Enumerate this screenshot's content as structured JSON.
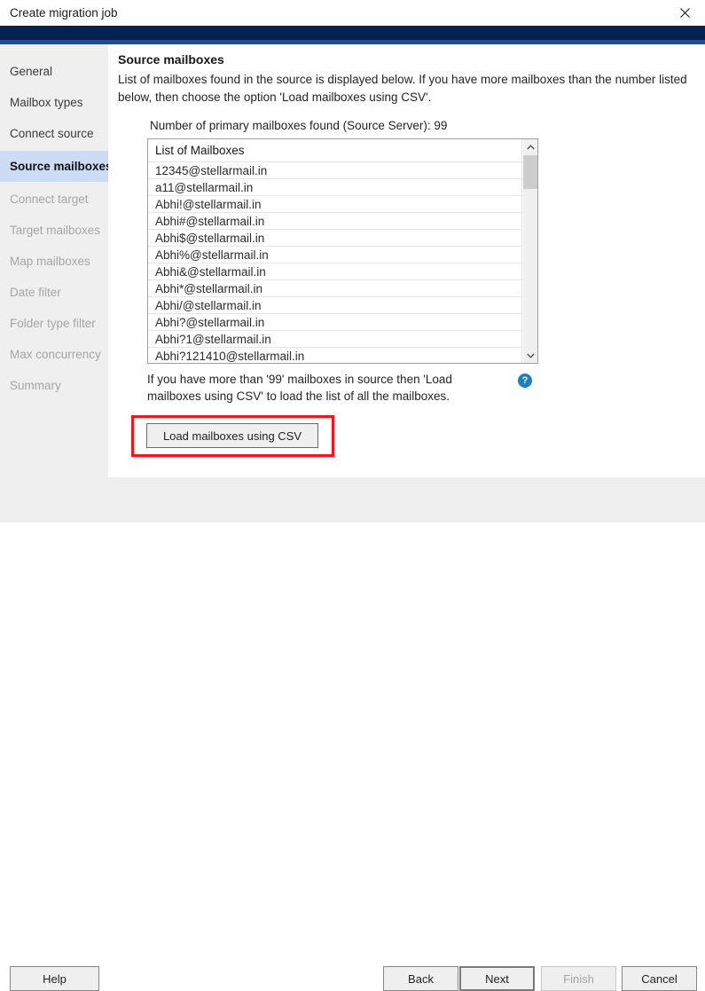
{
  "window": {
    "title": "Create migration job",
    "close_icon": "close-icon",
    "accent_navy": "#032254",
    "accent_blue": "#1f4b94"
  },
  "sidebar": {
    "items": [
      {
        "label": "General",
        "state": "enabled"
      },
      {
        "label": "Mailbox types",
        "state": "enabled"
      },
      {
        "label": "Connect source",
        "state": "enabled"
      },
      {
        "label": "Source mailboxes",
        "state": "selected"
      },
      {
        "label": "Connect target",
        "state": "disabled"
      },
      {
        "label": "Target mailboxes",
        "state": "disabled"
      },
      {
        "label": "Map mailboxes",
        "state": "disabled"
      },
      {
        "label": "Date filter",
        "state": "disabled"
      },
      {
        "label": "Folder type filter",
        "state": "disabled"
      },
      {
        "label": "Max concurrency",
        "state": "disabled"
      },
      {
        "label": "Summary",
        "state": "disabled"
      }
    ],
    "selected_bg": "#cddcf2"
  },
  "content": {
    "title": "Source mailboxes",
    "description": "List of mailboxes found in the source is displayed below. If you have more mailboxes than the number listed below, then choose the option 'Load mailboxes using CSV'.",
    "count_line": "Number of primary mailboxes found (Source Server): 99",
    "mailbox_count": 99,
    "list": {
      "header": "List of Mailboxes",
      "rows": [
        "12345@stellarmail.in",
        "a11@stellarmail.in",
        "Abhi!@stellarmail.in",
        "Abhi#@stellarmail.in",
        "Abhi$@stellarmail.in",
        "Abhi%@stellarmail.in",
        "Abhi&@stellarmail.in",
        "Abhi*@stellarmail.in",
        "Abhi/@stellarmail.in",
        "Abhi?@stellarmail.in",
        "Abhi?1@stellarmail.in",
        "Abhi?121410@stellarmail.in"
      ],
      "scroll_up_icon": "chevron-up-icon",
      "scroll_down_icon": "chevron-down-icon"
    },
    "hint": "If you have more than '99' mailboxes in source then 'Load mailboxes using CSV' to load the list of all the mailboxes.",
    "help_icon": "help-question-icon",
    "help_icon_color": "#1d7fc4",
    "csv_button": "Load mailboxes using CSV",
    "highlight_color": "#fb1414"
  },
  "footer": {
    "help": "Help",
    "back": "Back",
    "next": "Next",
    "finish": "Finish",
    "cancel": "Cancel"
  }
}
